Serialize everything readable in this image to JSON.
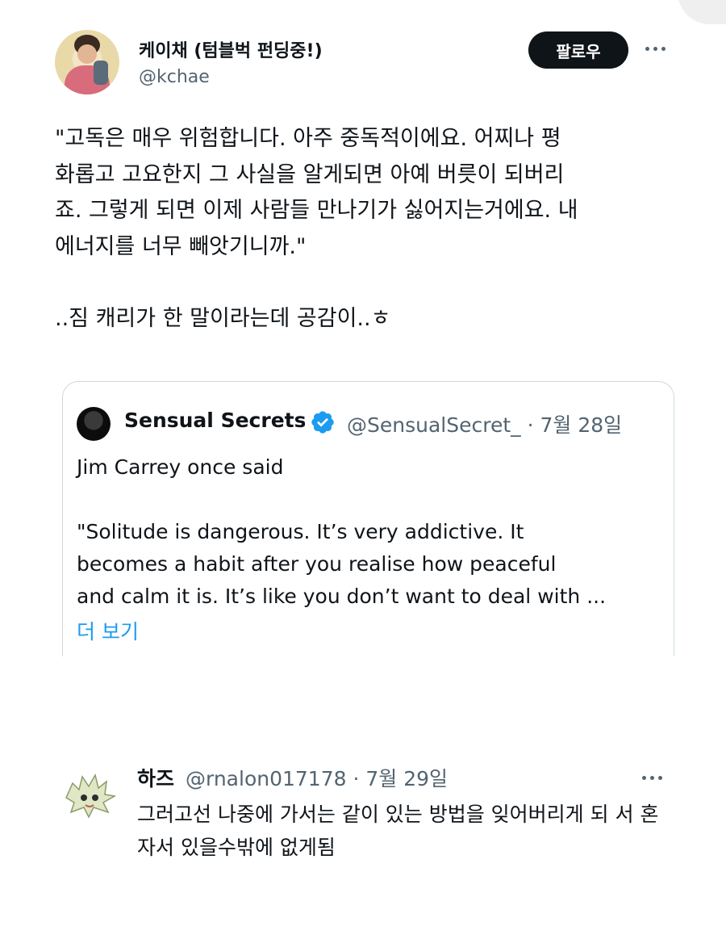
{
  "tweet": {
    "author_name": "케이채 (텀블벅 펀딩중!)",
    "author_handle": "@kchae",
    "follow_label": "팔로우",
    "more_icon": "more-horizontal-icon",
    "text": "\"고독은 매우 위험합니다. 아주 중독적이에요. 어찌나 평\n화롭고 고요한지 그 사실을 알게되면 아예 버릇이 되버리\n죠. 그렇게 되면 이제 사람들 만나기가 싫어지는거에요. 내\n에너지를 너무 빼앗기니까.\"\n\n..짐 캐리가 한 말이라는데 공감이..ㅎ"
  },
  "quote": {
    "author_name": "Sensual Secrets",
    "verified_icon": "verified-badge-icon",
    "verified_color": "#1d9bf0",
    "handle_date": "@SensualSecret_ · 7월 28일",
    "text": "Jim Carrey once said\n\n\"Solitude is dangerous. It’s very addictive. It\nbecomes a habit after you realise how peaceful\nand calm it is. It’s like you don’t want to deal with ...",
    "show_more": "더 보기"
  },
  "reply": {
    "author_name": "하즈",
    "handle_date": "@rnalon017178 · 7월 29일",
    "more_icon": "more-horizontal-icon",
    "text": "그러고선 나중에 가서는 같이 있는 방법을 잊어버리게 되\n서 혼자서 있을수밖에 없게됨"
  },
  "colors": {
    "text": "#0f1419",
    "secondary": "#536471",
    "accent": "#1d9bf0",
    "button_bg": "#0f1419"
  }
}
